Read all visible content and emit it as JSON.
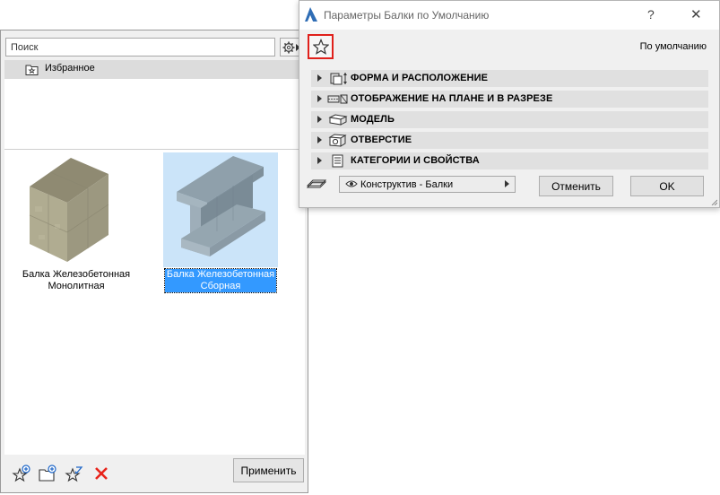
{
  "favorites_panel": {
    "search_placeholder": "Поиск",
    "folder_label": "Избранное",
    "items": [
      {
        "caption_line1": "Балка Железобетонная",
        "caption_line2": "Монолитная",
        "selected": false
      },
      {
        "caption_line1": "Балка Железобетонная",
        "caption_line2": "Сборная",
        "selected": true
      }
    ],
    "apply_label": "Применить",
    "icons": [
      "new-favorite-icon",
      "new-folder-icon",
      "redefine-favorite-icon",
      "delete-icon"
    ]
  },
  "dialog": {
    "title": "Параметры Балки по Умолчанию",
    "help_label": "?",
    "close_label": "✕",
    "default_label": "По умолчанию",
    "sections": [
      {
        "label": "ФОРМА И РАСПОЛОЖЕНИЕ",
        "icon": "geometry-position-icon"
      },
      {
        "label": "ОТОБРАЖЕНИЕ НА ПЛАНЕ И В РАЗРЕЗЕ",
        "icon": "plan-section-icon"
      },
      {
        "label": "МОДЕЛЬ",
        "icon": "model-icon"
      },
      {
        "label": "ОТВЕРСТИЕ",
        "icon": "hole-icon"
      },
      {
        "label": "КАТЕГОРИИ И СВОЙСТВА",
        "icon": "categories-icon"
      }
    ],
    "view_select": "Конструктив - Балки",
    "cancel_label": "Отменить",
    "ok_label": "OK"
  },
  "colors": {
    "selection_bg": "#3399ff",
    "selection_thumb_bg": "#cbe4f9",
    "highlight_border": "#e0201b",
    "delete_red": "#e8231a",
    "icon_blue": "#1f67c8"
  }
}
